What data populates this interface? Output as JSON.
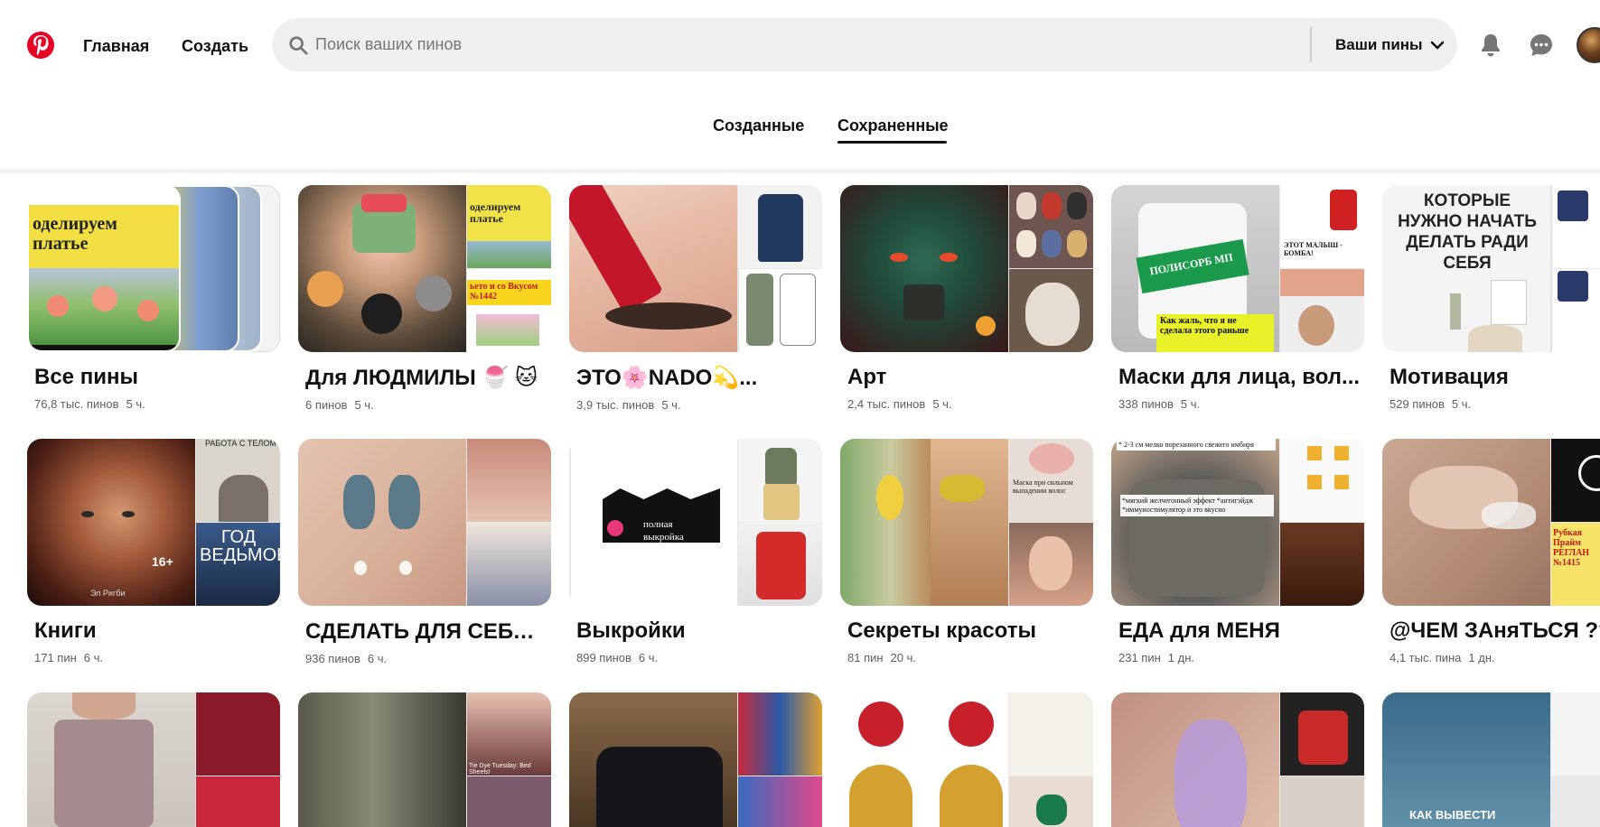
{
  "header": {
    "home_label": "Главная",
    "create_label": "Создать",
    "search_placeholder": "Поиск ваших пинов",
    "search_scope_label": "Ваши пины",
    "logo_icon": "pinterest-logo-icon",
    "notifications_icon": "bell-icon",
    "messages_icon": "chat-bubble-icon"
  },
  "tabs": {
    "created_label": "Созданные",
    "saved_label": "Сохраненные",
    "active": "saved"
  },
  "boards": [
    {
      "title": "Все пины",
      "count": "76,8 тыс. пинов",
      "time": "5 ч.",
      "cover_text": "оделируем платье"
    },
    {
      "title": "Для ЛЮДМИЛЫ 🍧 🐱",
      "count": "6 пинов",
      "time": "5 ч.",
      "cover_text": "оделируем платье",
      "cover_text2": "ьето и со Вкусом №1442"
    },
    {
      "title": "ЭТО🌸NADO💫...",
      "count": "3,9 тыс. пинов",
      "time": "5 ч."
    },
    {
      "title": "Арт",
      "count": "2,4 тыс. пинов",
      "time": "5 ч."
    },
    {
      "title": "Маски для лица, вол...",
      "count": "338 пинов",
      "time": "5 ч.",
      "cover_text": "ПОЛИСОРБ МП",
      "cover_text2": "Как жаль, что я не сделала этого раньше",
      "cover_text3": "ЭТОТ МАЛЫШ - БОМБА!"
    },
    {
      "title": "Мотивация",
      "count": "529 пинов",
      "time": "5 ч.",
      "cover_text": "КОТОРЫЕ НУЖНО НАЧАТЬ ДЕЛАТЬ РАДИ СЕБЯ"
    },
    {
      "title": "Книги",
      "count": "171 пин",
      "time": "6 ч.",
      "cover_text": "Эл Ригби",
      "cover_text2": "ГОД ВЕДЬМОВСТВА",
      "cover_text3": "РАБОТА С ТЕЛОМ",
      "cover_badge": "16+"
    },
    {
      "title": "СДЕЛАТЬ ДЛЯ СЕБЯ 💕",
      "count": "936 пинов",
      "time": "6 ч."
    },
    {
      "title": "Выкройки",
      "count": "899 пинов",
      "time": "6 ч.",
      "cover_text": "полная выкройка"
    },
    {
      "title": "Секреты красоты",
      "count": "81 пин",
      "time": "20 ч.",
      "cover_text": "Маска при сильном выпадении волос"
    },
    {
      "title": "ЕДА для МЕНЯ",
      "count": "231 пин",
      "time": "1 дн.",
      "cover_text": "*мягкий желчегонный эффект *антигэйдж *иммуностимулятор и это вкусно",
      "cover_text2": "* 2-3 см мелко порезанного свежего имбиря"
    },
    {
      "title": "@ЧЕМ ЗАняТЬСЯ ???",
      "count": "4,1 тыс. пина",
      "time": "1 дн.",
      "cover_text": "Рубкая Прайм РЕГЛАН №1415"
    },
    {
      "title": "",
      "count": "",
      "time": ""
    },
    {
      "title": "",
      "count": "",
      "time": "",
      "cover_text": "Tie Dye Tuesday: Bed Sheets!"
    },
    {
      "title": "",
      "count": "",
      "time": ""
    },
    {
      "title": "",
      "count": "",
      "time": ""
    },
    {
      "title": "",
      "count": "",
      "time": ""
    },
    {
      "title": "",
      "count": "",
      "time": "",
      "cover_text": "КАК ВЫВЕСТИ"
    }
  ],
  "colors": {
    "brand": "#e60023",
    "search_bg": "#efefef",
    "text": "#111111",
    "meta_text": "#5f5f5f"
  }
}
